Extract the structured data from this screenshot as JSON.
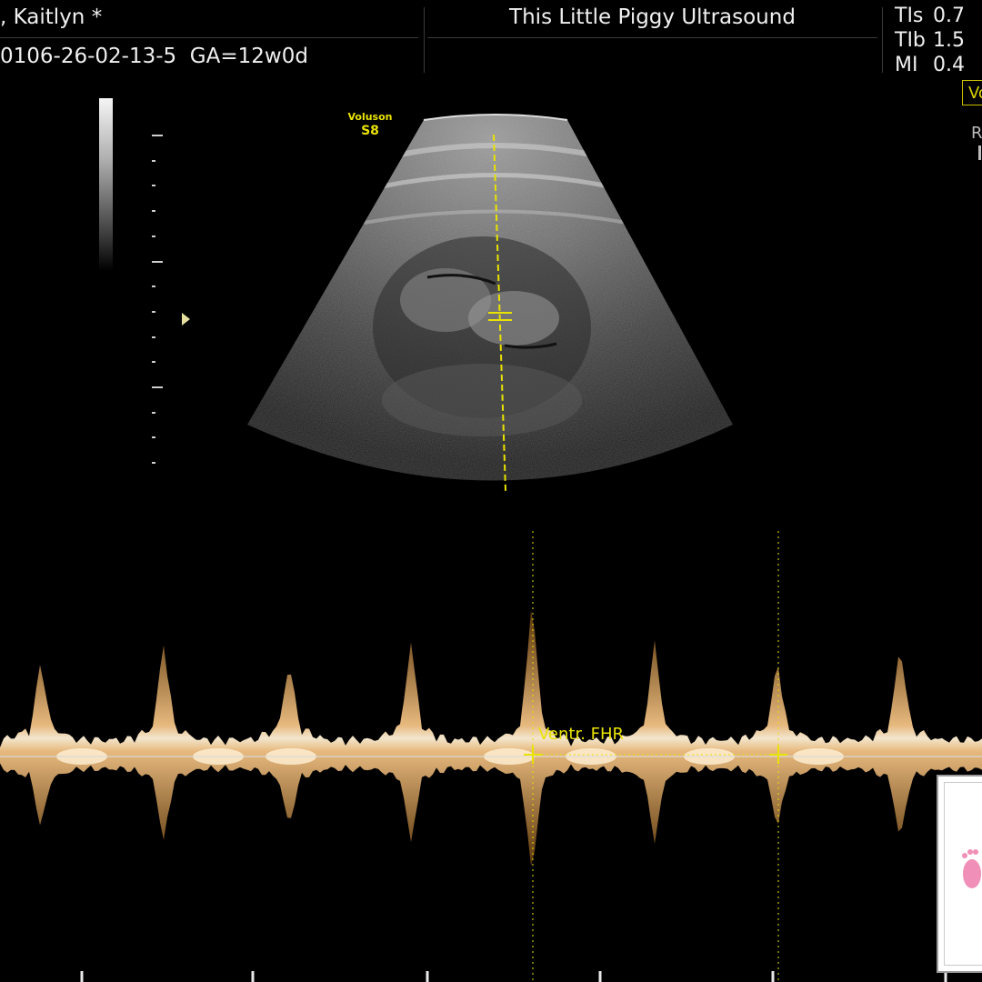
{
  "header": {
    "patient_name": ", Kaitlyn  *",
    "patient_id": "0106-26-02-13-5",
    "ga": "GA=12w0d",
    "clinic": "This Little Piggy Ultrasound",
    "indices": [
      {
        "label": "TIs",
        "value": "0.7"
      },
      {
        "label": "TIb",
        "value": "1.5"
      },
      {
        "label": "MI",
        "value": "0.4"
      }
    ],
    "mode_tag": "Vo",
    "right_label": "R"
  },
  "logo": {
    "line1": "Voluson",
    "line2": "S8"
  },
  "doppler": {
    "label": "Ventr. FHR"
  },
  "colors": {
    "caliper": "#e9e300",
    "doppler": "#f0b870",
    "background": "#000000"
  }
}
